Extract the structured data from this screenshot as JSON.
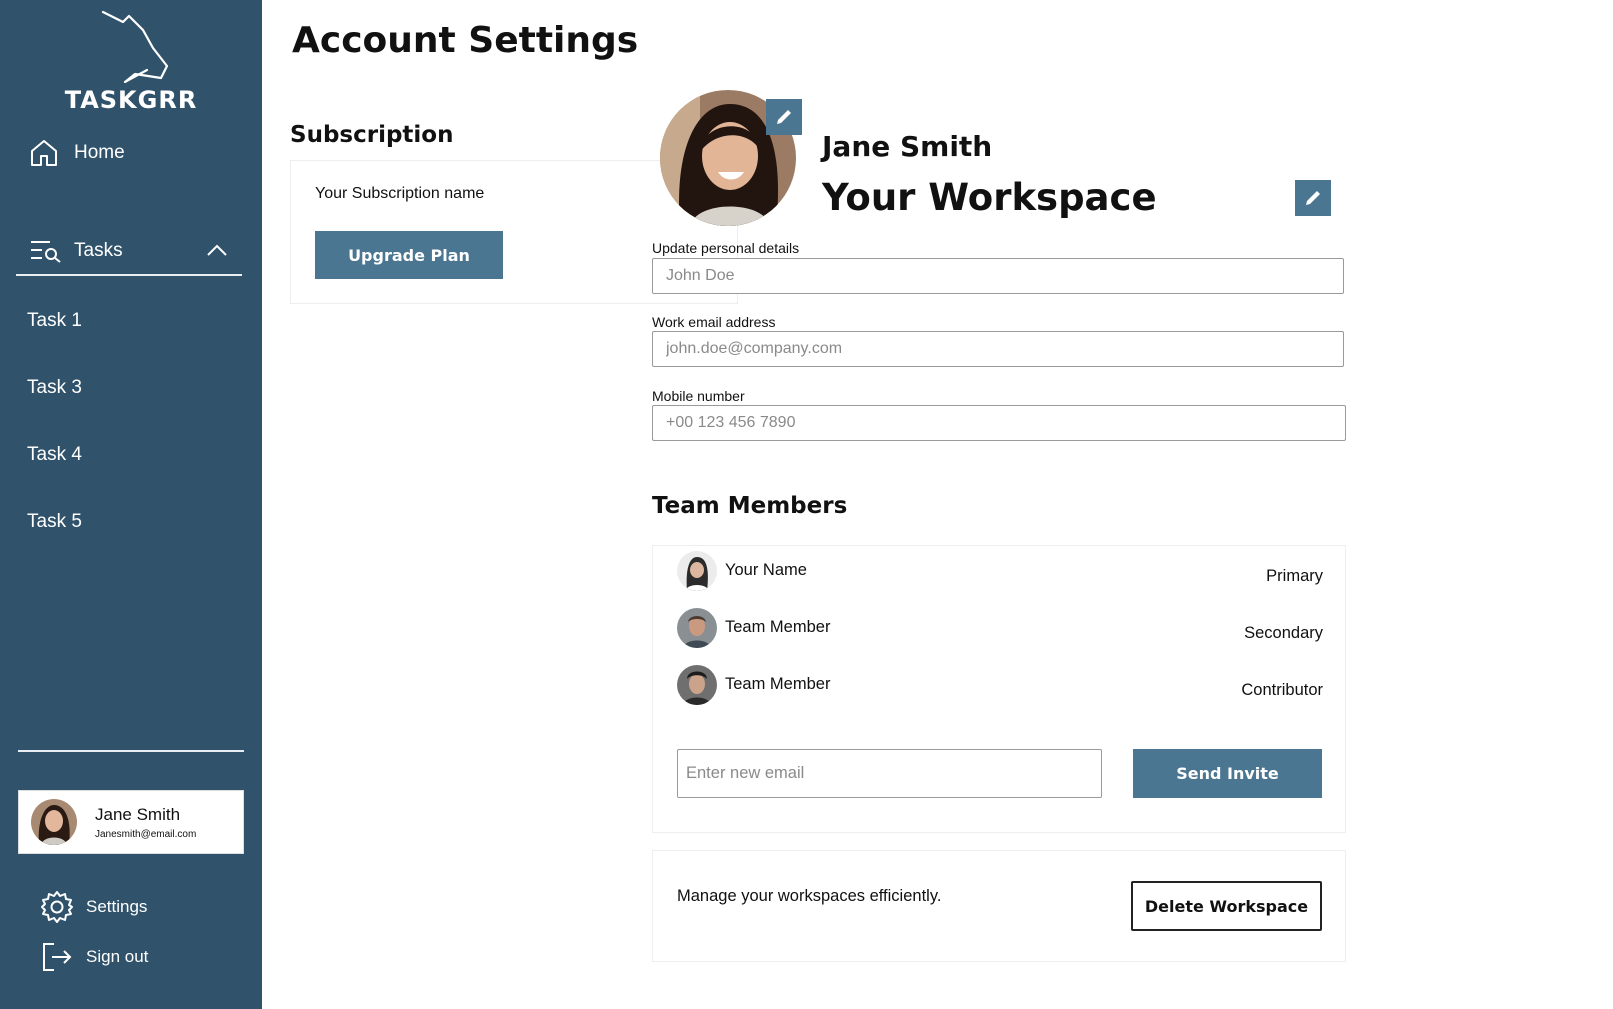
{
  "sidebar": {
    "logo_text": "TASKGRR",
    "home_label": "Home",
    "tasks_label": "Tasks",
    "tasks_expanded": true,
    "task_items": [
      {
        "label": "Task 1"
      },
      {
        "label": "Task 3"
      },
      {
        "label": "Task 4"
      },
      {
        "label": "Task 5"
      }
    ],
    "user": {
      "name": "Jane Smith",
      "email": "Janesmith@email.com"
    },
    "settings_label": "Settings",
    "signout_label": "Sign out"
  },
  "main": {
    "page_title": "Account Settings",
    "subscription": {
      "title": "Subscription",
      "name": "Your Subscription name",
      "upgrade_label": "Upgrade Plan"
    },
    "profile": {
      "name": "Jane Smith",
      "workspace": "Your Workspace"
    },
    "fields": {
      "personal_label": "Update personal details",
      "personal_placeholder": "John Doe",
      "email_label": "Work email address",
      "email_placeholder": "john.doe@company.com",
      "mobile_label": "Mobile number",
      "mobile_placeholder": "+00 123 456 7890"
    },
    "team": {
      "title": "Team Members",
      "members": [
        {
          "name": "Your Name",
          "role": "Primary"
        },
        {
          "name": "Team Member",
          "role": "Secondary"
        },
        {
          "name": "Team Member",
          "role": "Contributor"
        }
      ],
      "invite_placeholder": "Enter new email",
      "send_label": "Send Invite"
    },
    "manage": {
      "text": "Manage your workspaces efficiently.",
      "delete_label": "Delete Workspace"
    }
  },
  "colors": {
    "sidebar_bg": "#30536b",
    "accent": "#4b7692"
  },
  "icons": [
    "home-icon",
    "tasks-search-icon",
    "chevron-up-icon",
    "gear-icon",
    "sign-out-icon",
    "pencil-icon"
  ]
}
